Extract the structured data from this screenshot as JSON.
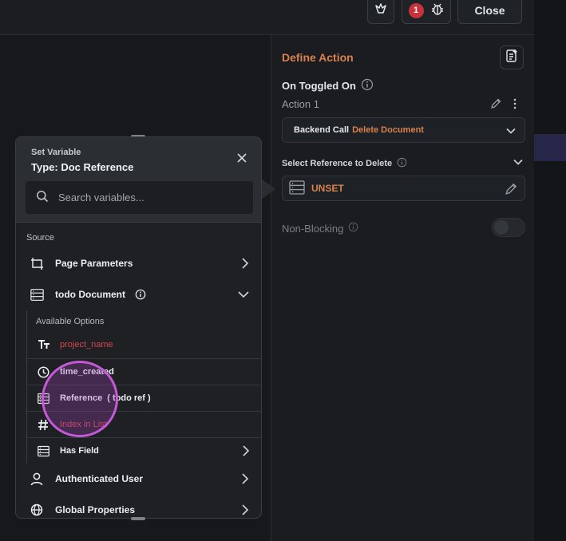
{
  "topbar": {
    "badge_count": "1",
    "close_label": "Close"
  },
  "panel": {
    "title": "Define Action",
    "trigger": "On Toggled On",
    "action_label": "Action 1",
    "action_kind": "Backend Call",
    "action_value": "Delete Document",
    "ref_label": "Select Reference to Delete",
    "unset_label": "UNSET",
    "nonblocking_label": "Non-Blocking"
  },
  "popover": {
    "subtitle": "Set Variable",
    "type_label": "Type: Doc Reference",
    "search_placeholder": "Search variables...",
    "source_label": "Source",
    "items": [
      {
        "label": "Page Parameters"
      },
      {
        "label": "todo Document"
      },
      {
        "label": "Authenticated User"
      },
      {
        "label": "Global Properties"
      }
    ],
    "available_label": "Available Options",
    "options": [
      {
        "label": "project_name"
      },
      {
        "label": "time_created"
      },
      {
        "label": "Reference  ( todo ref )"
      },
      {
        "label": "Index in List"
      },
      {
        "label": "Has Field"
      }
    ]
  },
  "colors": {
    "accent": "#d9824f",
    "error": "#d8454e",
    "touch": "#c45ad6"
  }
}
